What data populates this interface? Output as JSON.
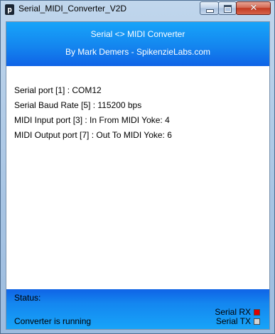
{
  "window": {
    "title": "Serial_MIDI_Converter_V2D",
    "icon": "app-icon",
    "icon_glyph": "p"
  },
  "header": {
    "title": "Serial <> MIDI Converter",
    "author": "By Mark Demers - SpikenzieLabs.com"
  },
  "settings": [
    {
      "text": "Serial port [1] : COM12"
    },
    {
      "text": "Serial Baud Rate [5] : 115200 bps"
    },
    {
      "text": "MIDI Input port [3] : In From MIDI Yoke:  4"
    },
    {
      "text": "MIDI Output port [7] : Out To MIDI Yoke:  6"
    }
  ],
  "status": {
    "label": "Status:",
    "text": "Converter is running"
  },
  "indicators": {
    "rx": {
      "label": "Serial RX",
      "color": "#e00000"
    },
    "tx": {
      "label": "Serial TX",
      "color": "#d4d4d4"
    }
  },
  "colors": {
    "header_blue": "#1486ef",
    "footer_blue": "#0f63e6"
  }
}
